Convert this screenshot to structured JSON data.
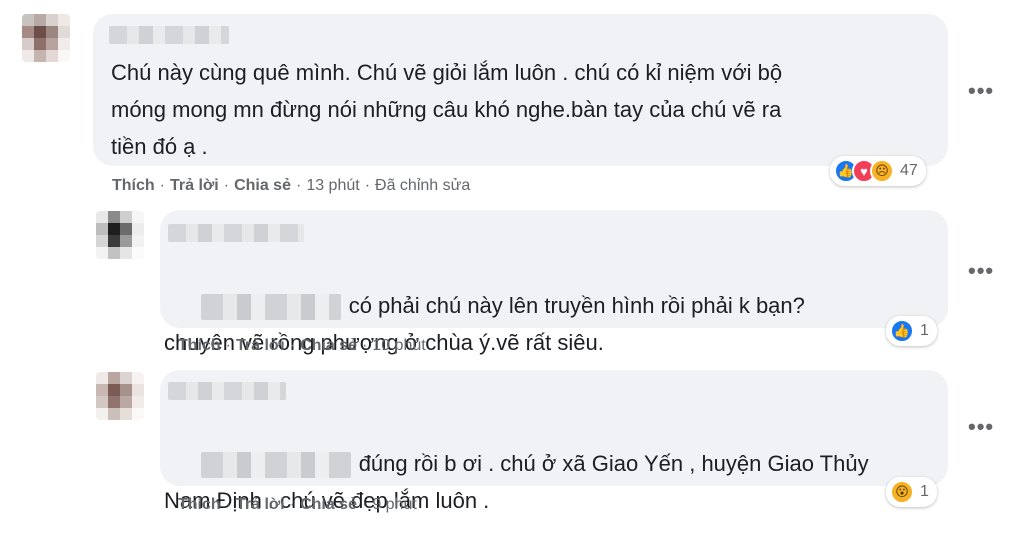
{
  "comments": [
    {
      "text": "Chú này cùng quê mình. Chú vẽ giỏi lắm luôn . chú có kỉ niệm với bộ\nmóng mong mn đừng nói những câu khó nghe.bàn tay của chú vẽ ra\ntiền đó ạ .",
      "actions": {
        "like": "Thích",
        "reply": "Trả lời",
        "share": "Chia sẻ",
        "time": "13 phút",
        "edited": "Đã chỉnh sửa"
      },
      "reaction_count": "47",
      "reaction_icons": [
        "like-icon",
        "love-icon",
        "sad-icon"
      ],
      "more": "•••"
    },
    {
      "text": "có phải chú này lên truyền hình rồi phải k bạn?\nchuyên vẽ rồng phượng ở chùa ý.vẽ rất siêu.",
      "actions": {
        "like": "Thích",
        "reply": "Trả lời",
        "share": "Chia sẻ",
        "time": "10 phút"
      },
      "reaction_count": "1",
      "reaction_icons": [
        "like-icon"
      ],
      "more": "•••"
    },
    {
      "text": "đúng rồi b ơi . chú ở xã Giao Yến , huyện Giao Thủy\nNam Định . chú vẽ đẹp lắm luôn .",
      "actions": {
        "like": "Thích",
        "reply": "Trả lời",
        "share": "Chia sẻ",
        "time": "9 phút"
      },
      "reaction_count": "1",
      "reaction_icons": [
        "wow-icon"
      ],
      "more": "•••"
    }
  ],
  "colors": {
    "bubble": "#f0f2f5",
    "meta": "#65676b",
    "like": "#1877f2",
    "love": "#f33e58",
    "wow": "#f7b125"
  }
}
